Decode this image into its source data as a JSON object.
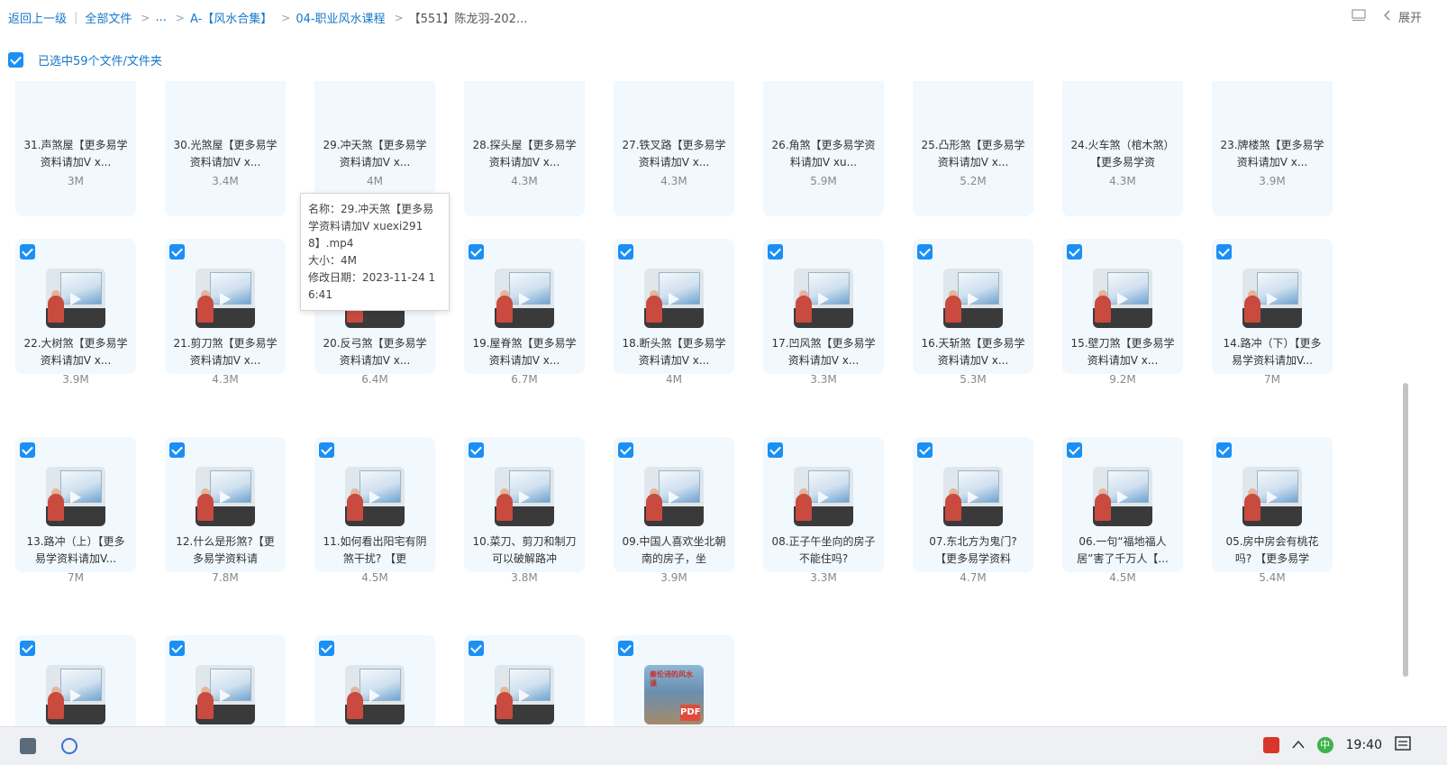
{
  "breadcrumb": {
    "back": "返回上一级",
    "all_files": "全部文件",
    "ellipsis": "...",
    "folder1": "A-【风水合集】",
    "folder2": "04-职业风水课程",
    "current": "【551】陈龙羽-202..."
  },
  "header": {
    "expand_label": "展开"
  },
  "selection": {
    "label": "已选中59个文件/文件夹"
  },
  "files": [
    {
      "name": "31.声煞屋【更多易学资料请加V x...",
      "size": "3M",
      "type": "video"
    },
    {
      "name": "30.光煞屋【更多易学资料请加V x...",
      "size": "3.4M",
      "type": "video"
    },
    {
      "name": "29.冲天煞【更多易学资料请加V x...",
      "size": "4M",
      "type": "video"
    },
    {
      "name": "28.探头屋【更多易学资料请加V x...",
      "size": "4.3M",
      "type": "video"
    },
    {
      "name": "27.铁叉路【更多易学资料请加V x...",
      "size": "4.3M",
      "type": "video"
    },
    {
      "name": "26.角煞【更多易学资料请加V xu...",
      "size": "5.9M",
      "type": "video"
    },
    {
      "name": "25.凸形煞【更多易学资料请加V x...",
      "size": "5.2M",
      "type": "video"
    },
    {
      "name": "24.火车煞（棺木煞）【更多易学资",
      "size": "4.3M",
      "type": "video"
    },
    {
      "name": "23.牌楼煞【更多易学资料请加V x...",
      "size": "3.9M",
      "type": "video"
    },
    {
      "name": "22.大树煞【更多易学资料请加V x...",
      "size": "3.9M",
      "type": "video"
    },
    {
      "name": "21.剪刀煞【更多易学资料请加V x...",
      "size": "4.3M",
      "type": "video"
    },
    {
      "name": "20.反弓煞【更多易学资料请加V x...",
      "size": "6.4M",
      "type": "video"
    },
    {
      "name": "19.屋脊煞【更多易学资料请加V x...",
      "size": "6.7M",
      "type": "video"
    },
    {
      "name": "18.断头煞【更多易学资料请加V x...",
      "size": "4M",
      "type": "video"
    },
    {
      "name": "17.凹风煞【更多易学资料请加V x...",
      "size": "3.3M",
      "type": "video"
    },
    {
      "name": "16.天斩煞【更多易学资料请加V x...",
      "size": "5.3M",
      "type": "video"
    },
    {
      "name": "15.壁刀煞【更多易学资料请加V x...",
      "size": "9.2M",
      "type": "video"
    },
    {
      "name": "14.路冲（下）【更多易学资料请加V...",
      "size": "7M",
      "type": "video"
    },
    {
      "name": "13.路冲（上）【更多易学资料请加V...",
      "size": "7M",
      "type": "video"
    },
    {
      "name": "12.什么是形煞?【更多易学资料请",
      "size": "7.8M",
      "type": "video"
    },
    {
      "name": "11.如何看出阳宅有阴煞干扰? 【更",
      "size": "4.5M",
      "type": "video"
    },
    {
      "name": "10.菜刀、剪刀和制刀可以破解路冲",
      "size": "3.8M",
      "type": "video"
    },
    {
      "name": "09.中国人喜欢坐北朝南的房子，坐",
      "size": "3.9M",
      "type": "video"
    },
    {
      "name": "08.正子午坐向的房子不能住吗?",
      "size": "3.3M",
      "type": "video"
    },
    {
      "name": "07.东北方为鬼门?【更多易学资料",
      "size": "4.7M",
      "type": "video"
    },
    {
      "name": "06.一句“福地福人居”害了千万人【...",
      "size": "4.5M",
      "type": "video"
    },
    {
      "name": "05.房中房会有桃花吗? 【更多易学",
      "size": "5.4M",
      "type": "video"
    },
    {
      "name": "",
      "size": "",
      "type": "video"
    },
    {
      "name": "",
      "size": "",
      "type": "video"
    },
    {
      "name": "",
      "size": "",
      "type": "video"
    },
    {
      "name": "",
      "size": "",
      "type": "video"
    },
    {
      "name": "",
      "size": "",
      "type": "pdf",
      "thumb_text": "秦伦诗的风水课"
    }
  ],
  "tooltip": {
    "name_line": "名称：29.冲天煞【更多易学资料请加V xuexi2918】.mp4",
    "size_line": "大小：4M",
    "date_line": "修改日期：2023-11-24 16:41"
  },
  "taskbar": {
    "time": "19:40",
    "ime": "中"
  },
  "colors": {
    "accent": "#1677c9",
    "checkbox": "#1a8ff5",
    "tile_bg": "#f1f8fe"
  }
}
